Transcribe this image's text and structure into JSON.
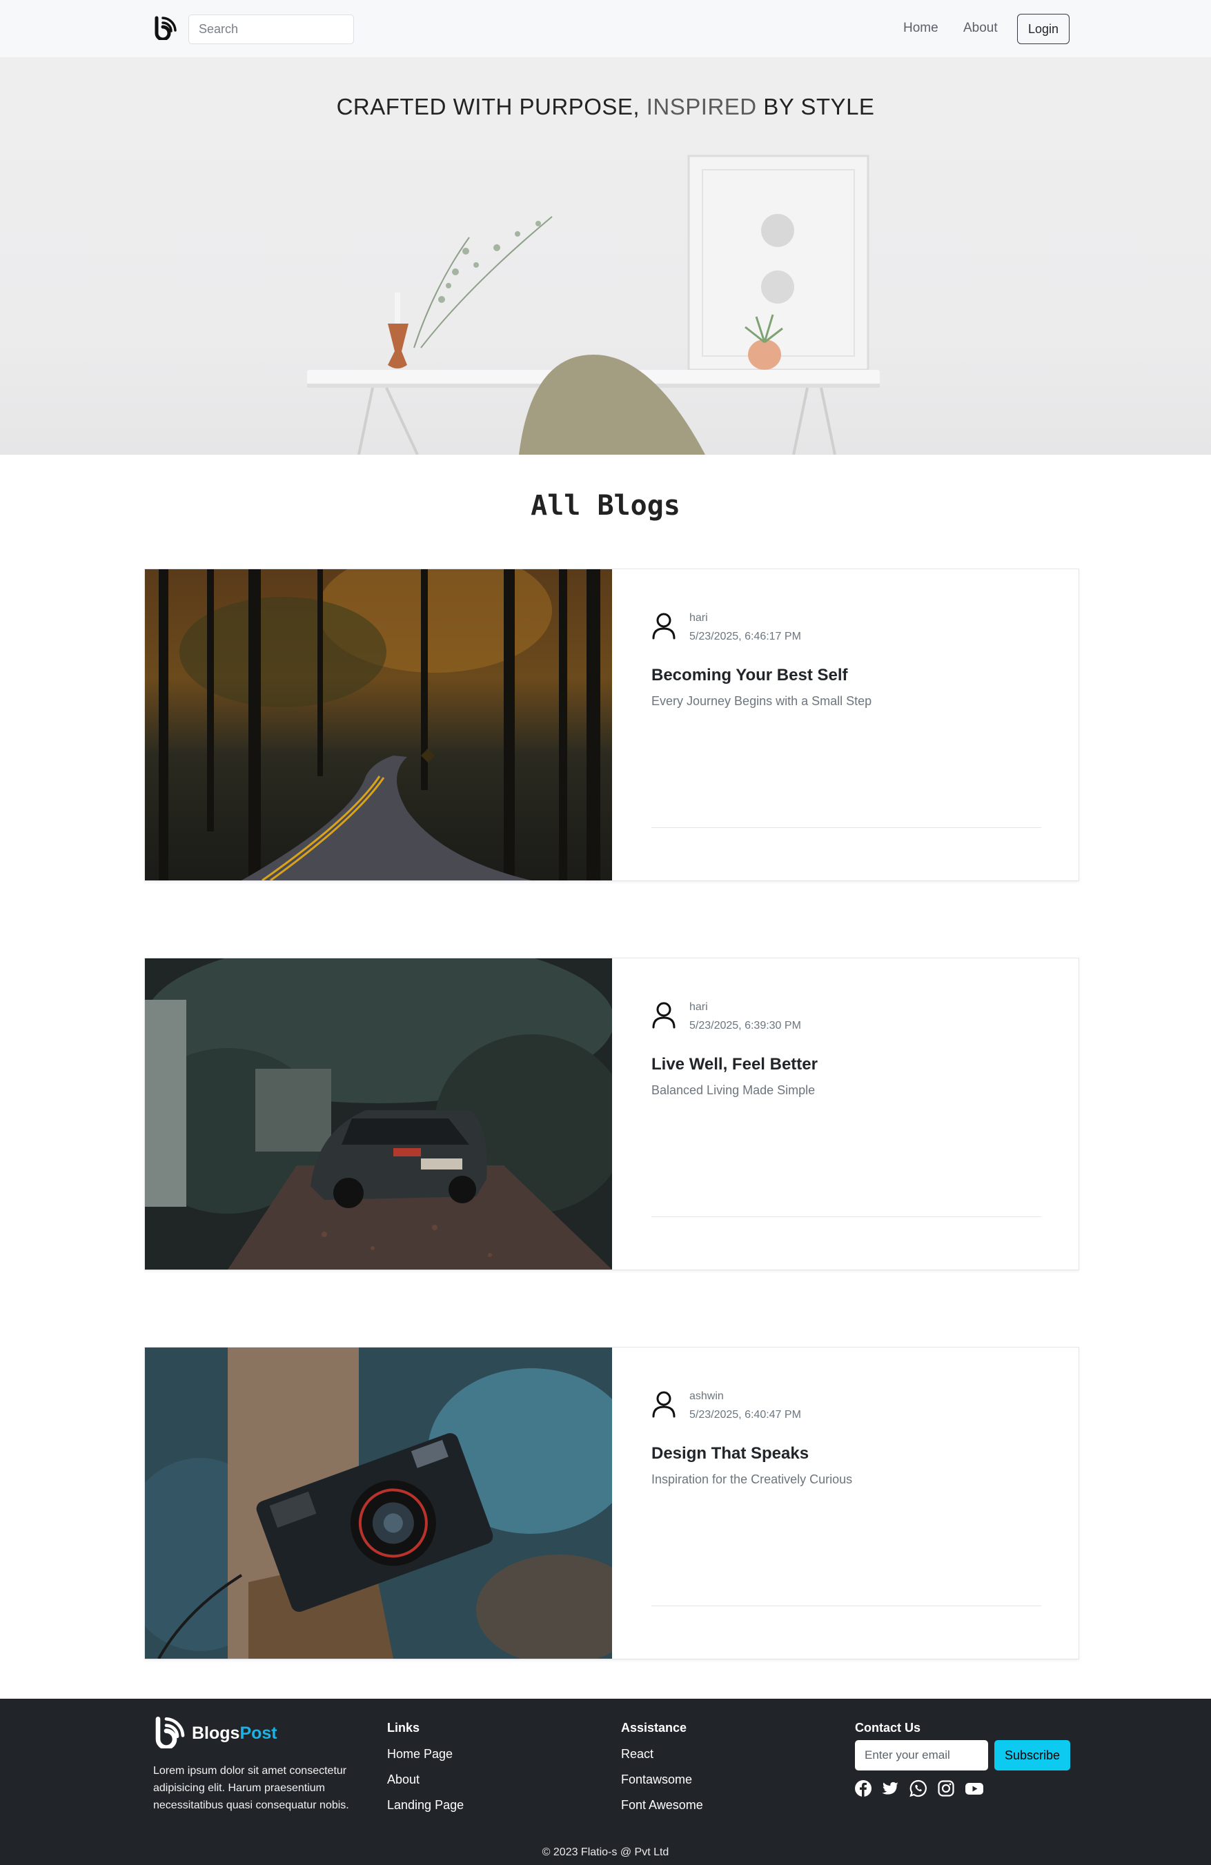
{
  "nav": {
    "search_placeholder": "Search",
    "links": [
      "Home",
      "About"
    ],
    "login_label": "Login"
  },
  "hero": {
    "title_part1": "CRAFTED WITH PURPOSE, ",
    "title_highlight": "INSPIRED",
    "title_part2": " BY STYLE"
  },
  "main": {
    "section_title": "All Blogs",
    "posts": [
      {
        "author": "hari",
        "date": "5/23/2025, 6:46:17 PM",
        "title": "Becoming Your Best Self",
        "subtitle": "Every Journey Begins with a Small Step"
      },
      {
        "author": "hari",
        "date": "5/23/2025, 6:39:30 PM",
        "title": "Live Well, Feel Better",
        "subtitle": "Balanced Living Made Simple"
      },
      {
        "author": "ashwin",
        "date": "5/23/2025, 6:40:47 PM",
        "title": "Design That Speaks",
        "subtitle": "Inspiration for the Creatively Curious"
      }
    ]
  },
  "footer": {
    "brand_part1": "Blogs",
    "brand_part2": "Post",
    "description": "Lorem ipsum dolor sit amet consectetur adipisicing elit. Harum praesentium necessitatibus quasi consequatur nobis.",
    "links_title": "Links",
    "links": [
      "Home Page",
      "About",
      "Landing Page"
    ],
    "assistance_title": "Assistance",
    "assistance": [
      "React",
      "Fontawsome",
      "Font Awesome"
    ],
    "contact_title": "Contact Us",
    "email_placeholder": "Enter your email",
    "subscribe_label": "Subscribe",
    "social_icons": [
      "facebook-icon",
      "twitter-icon",
      "whatsapp-icon",
      "instagram-icon",
      "youtube-icon"
    ],
    "copyright": "© 2023 Flatio-s @ Pvt Ltd"
  },
  "colors": {
    "footer_bg": "#212529",
    "accent": "#0dcaf0",
    "brand_accent": "#1ab3e6"
  }
}
